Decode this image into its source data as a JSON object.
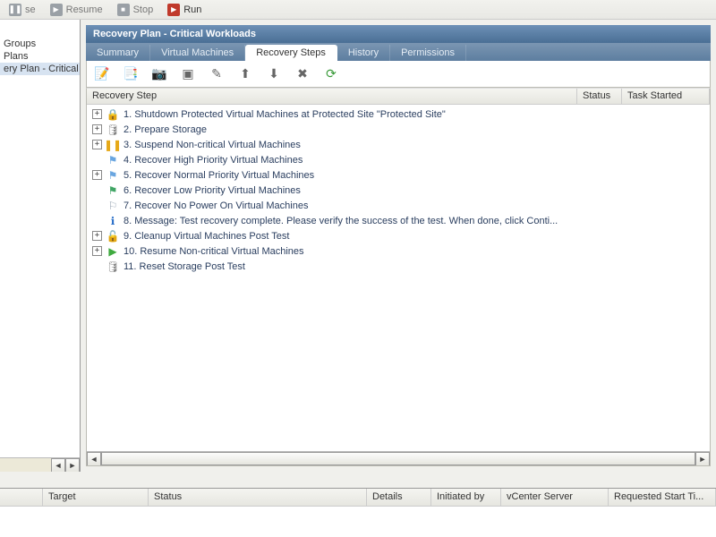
{
  "toolbar": {
    "pause": "se",
    "resume": "Resume",
    "stop": "Stop",
    "run": "Run"
  },
  "left": {
    "item_groups": "Groups",
    "item_plans": "Plans",
    "item_plan": "ery Plan - Critical V"
  },
  "header": {
    "title": "Recovery Plan - Critical Workloads"
  },
  "tabs": {
    "summary": "Summary",
    "vms": "Virtual Machines",
    "steps": "Recovery Steps",
    "history": "History",
    "perms": "Permissions"
  },
  "grid_head": {
    "step": "Recovery Step",
    "status": "Status",
    "task_started": "Task Started"
  },
  "steps": [
    {
      "expand": "+",
      "icon": "shutdown-icon",
      "glyph": "🔒",
      "color": "#c03030",
      "label": "1. Shutdown Protected Virtual Machines at Protected Site \"Protected Site\""
    },
    {
      "expand": "+",
      "icon": "storage-icon",
      "glyph": "🛢",
      "color": "#888",
      "label": "2. Prepare Storage"
    },
    {
      "expand": "+",
      "icon": "suspend-icon",
      "glyph": "❚❚",
      "color": "#e6a817",
      "label": "3. Suspend Non-critical Virtual Machines"
    },
    {
      "expand": "",
      "icon": "flag-icon",
      "glyph": "⚑",
      "color": "#6aa6e0",
      "label": "4. Recover High Priority Virtual Machines"
    },
    {
      "expand": "+",
      "icon": "flag-icon",
      "glyph": "⚑",
      "color": "#6aa6e0",
      "label": "5. Recover Normal Priority Virtual Machines"
    },
    {
      "expand": "",
      "icon": "flag-icon",
      "glyph": "⚑",
      "color": "#41a565",
      "label": "6. Recover Low Priority Virtual Machines"
    },
    {
      "expand": "",
      "icon": "flag-outline-icon",
      "glyph": "⚐",
      "color": "#9aa7b4",
      "label": "7. Recover No Power On Virtual Machines"
    },
    {
      "expand": "",
      "icon": "info-icon",
      "glyph": "ℹ",
      "color": "#2a6fc9",
      "label": "8. Message: Test recovery complete. Please verify the success of the test. When done, click Conti..."
    },
    {
      "expand": "+",
      "icon": "cleanup-icon",
      "glyph": "🔓",
      "color": "#c03030",
      "label": "9. Cleanup Virtual Machines Post Test"
    },
    {
      "expand": "+",
      "icon": "resume-icon",
      "glyph": "▶",
      "color": "#3faa3f",
      "label": "10. Resume Non-critical Virtual Machines"
    },
    {
      "expand": "",
      "icon": "storage-icon",
      "glyph": "🛢",
      "color": "#888",
      "label": "11. Reset Storage Post Test"
    }
  ],
  "status_head": {
    "c0": "",
    "target": "Target",
    "status": "Status",
    "details": "Details",
    "initiated": "Initiated by",
    "vcenter": "vCenter Server",
    "requested": "Requested Start Ti..."
  }
}
